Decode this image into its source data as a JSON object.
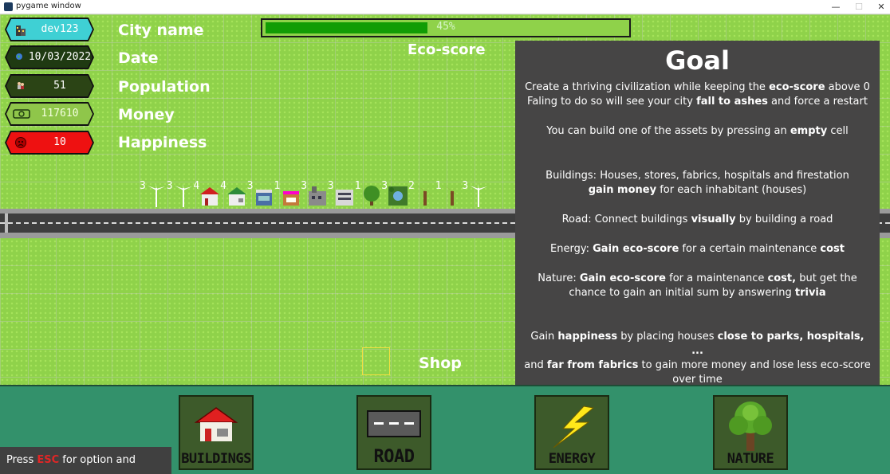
{
  "window": {
    "title": "pygame window",
    "minimize": "—",
    "maximize": "☐",
    "close": "✕"
  },
  "stats": {
    "city": {
      "value": "dev123",
      "label": "City name",
      "color": "#3fd0d4"
    },
    "date": {
      "value": "10/03/2022",
      "label": "Date",
      "color": "#1f3a12"
    },
    "population": {
      "value": "51",
      "label": "Population",
      "color": "#2b4415"
    },
    "money": {
      "value": "117610",
      "label": "Money",
      "color": "#8fc64a"
    },
    "happiness": {
      "value": "10",
      "label": "Happiness",
      "color": "#ee1111"
    }
  },
  "eco": {
    "label": "Eco-score",
    "percent_text": "45%",
    "percent": 45,
    "fill_color": "#129c05"
  },
  "assets": [
    {
      "count": "3",
      "icon": "wind-turbine-icon"
    },
    {
      "count": "3",
      "icon": "wind-turbine-icon"
    },
    {
      "count": "4",
      "icon": "house-red-icon"
    },
    {
      "count": "4",
      "icon": "house-green-icon"
    },
    {
      "count": "3",
      "icon": "store-icon"
    },
    {
      "count": "1",
      "icon": "shop-icon"
    },
    {
      "count": "3",
      "icon": "factory-icon"
    },
    {
      "count": "3",
      "icon": "hospital-icon"
    },
    {
      "count": "1",
      "icon": "tree-icon"
    },
    {
      "count": "3",
      "icon": "park-icon"
    },
    {
      "count": "2",
      "icon": "windmill-icon"
    },
    {
      "count": "1",
      "icon": "windmill-icon"
    },
    {
      "count": "3",
      "icon": "wind-turbine-icon"
    }
  ],
  "goal": {
    "title": "Goal",
    "p1_a": "Create a thriving civilization while keeping the ",
    "p1_b": "eco-score",
    "p1_c": " above 0",
    "p2_a": "Faling to do so will see your city ",
    "p2_b": "fall to ashes",
    "p2_c": " and force a restart",
    "p3_a": "You can build one of the assets by pressing an ",
    "p3_b": "empty",
    "p3_c": " cell",
    "p4_a": "Buildings: Houses, stores, fabrics, hospitals and firestation",
    "p4_b": "gain money",
    "p4_c": " for each inhabitant (houses)",
    "p5_a": "Road: Connect buildings ",
    "p5_b": "visually",
    "p5_c": " by building a road",
    "p6_a": "Energy: ",
    "p6_b": "Gain eco-score",
    "p6_c": " for a certain maintenance ",
    "p6_d": "cost",
    "p7_a": "Nature: ",
    "p7_b": "Gain eco-score",
    "p7_c": " for a maintenance ",
    "p7_d": "cost,",
    "p7_e": " but get the chance to gain an initial sum by answering ",
    "p7_f": "trivia",
    "p8_a": "Gain ",
    "p8_b": "happiness",
    "p8_c": " by placing houses ",
    "p8_d": "close to parks, hospitals, ...",
    "p8_e": "and ",
    "p8_f": "far from fabrics",
    "p8_g": " to gain more money and lose less eco-score over time"
  },
  "shop": {
    "label": "Shop",
    "items": [
      {
        "label": "BUILDINGS",
        "icon": "house-icon"
      },
      {
        "label": "ROAD",
        "icon": "road-icon"
      },
      {
        "label": "ENERGY",
        "icon": "lightning-icon"
      },
      {
        "label": "NATURE",
        "icon": "tree-icon"
      }
    ]
  },
  "hint": {
    "a": "Press ",
    "esc": "ESC",
    "b": " for option and saving"
  }
}
